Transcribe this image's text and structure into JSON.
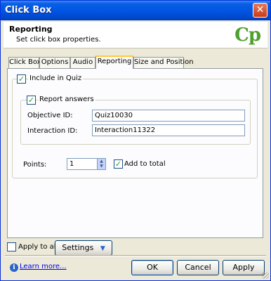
{
  "window": {
    "title": "Click Box",
    "close_symbol": "✕"
  },
  "header": {
    "title": "Reporting",
    "subtitle": "Set click box properties.",
    "logo_text": "Cp"
  },
  "tabs": [
    {
      "label": "Click Box"
    },
    {
      "label": "Options"
    },
    {
      "label": "Audio"
    },
    {
      "label": "Reporting",
      "active": true
    },
    {
      "label": "Size and Position"
    }
  ],
  "reporting": {
    "include_in_quiz": {
      "label": "Include in Quiz",
      "checked": true
    },
    "report_answers": {
      "label": "Report answers",
      "checked": true
    },
    "objective_id": {
      "label": "Objective ID:",
      "value": "Quiz10030"
    },
    "interaction_id": {
      "label": "Interaction ID:",
      "value": "Interaction11322"
    },
    "points": {
      "label": "Points:",
      "value": "1"
    },
    "add_to_total": {
      "label": "Add to total",
      "checked": true
    }
  },
  "footer": {
    "apply_to_all": {
      "label": "Apply to all",
      "checked": false
    },
    "settings_label": "Settings",
    "learn_more": "Learn more...",
    "ok": "OK",
    "cancel": "Cancel",
    "apply": "Apply"
  },
  "colors": {
    "titlebar": "#0054e3",
    "logo": "#4ea02e",
    "active_tab_accent": "#ffc83c",
    "dialog_bg": "#ece9d8"
  }
}
